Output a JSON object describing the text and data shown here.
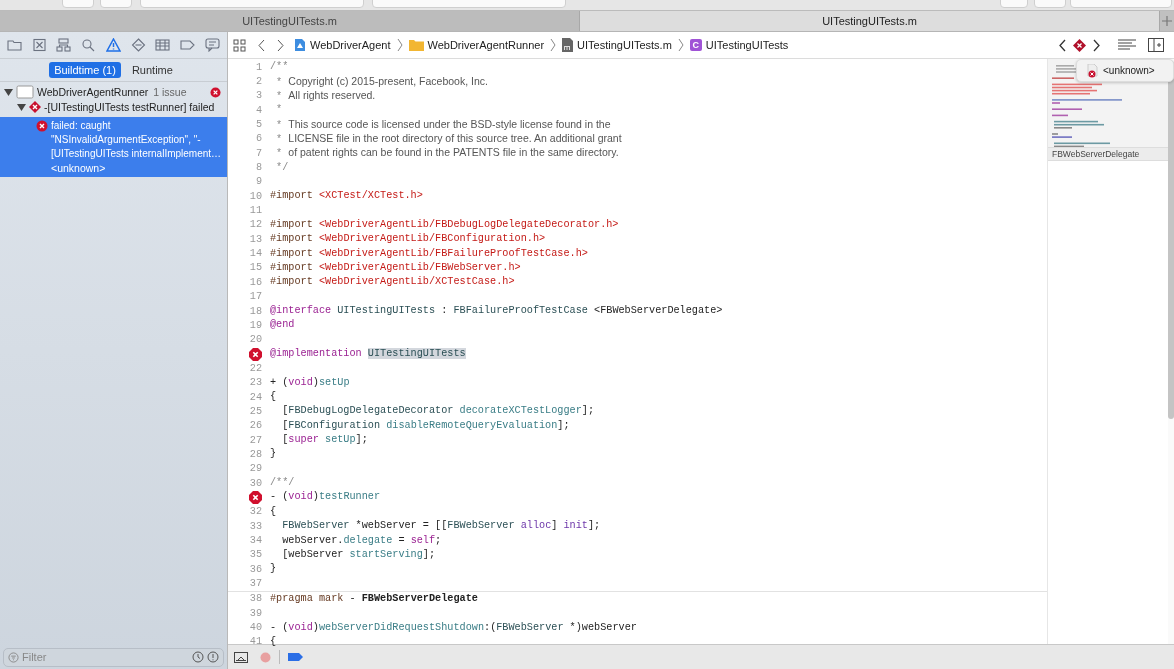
{
  "tabs": [
    {
      "label": "UITestingUITests.m",
      "selected": false
    },
    {
      "label": "UITestingUITests.m",
      "selected": true
    }
  ],
  "navigator_tabs": [
    {
      "selected": false
    },
    {
      "selected": false
    },
    {
      "selected": false
    },
    {
      "selected": false
    },
    {
      "selected": true
    },
    {
      "selected": false
    },
    {
      "selected": false
    },
    {
      "selected": false
    },
    {
      "selected": false
    }
  ],
  "scope": [
    {
      "label": "Buildtime (1)",
      "selected": true
    },
    {
      "label": "Runtime",
      "selected": false
    }
  ],
  "issues": [
    {
      "kind": "target",
      "label": "WebDriverAgentRunner",
      "count": "1 issue",
      "expanded": true,
      "selected": false,
      "children": [
        {
          "kind": "test",
          "label": "-[UITestingUITests testRunner] failed",
          "expanded": true,
          "selected": false,
          "children": [
            {
              "kind": "message",
              "label": "failed: caught \"NSInvalidArgumentException\", \"-[UITestingUITests internalImplement…",
              "detail": "<unknown>",
              "selected": true
            }
          ]
        }
      ]
    }
  ],
  "filter": {
    "placeholder": "Filter"
  },
  "jump_bar": [
    {
      "kind": "project",
      "label": "WebDriverAgent"
    },
    {
      "kind": "folder",
      "label": "WebDriverAgentRunner"
    },
    {
      "kind": "mfile",
      "label": "UITestingUITests.m"
    },
    {
      "kind": "class",
      "label": "UITestingUITests",
      "letter": "C"
    }
  ],
  "code_sections": [
    {
      "lines": [
        {
          "number": "1",
          "error": false,
          "tokens": [
            {
              "kind": "comment",
              "text": "/**"
            }
          ]
        },
        {
          "number": "2",
          "error": false,
          "tokens": [
            {
              "kind": "comment",
              "text": " * "
            },
            {
              "kind": "doc",
              "text": "Copyright (c) 2015-present, Facebook, Inc."
            }
          ]
        },
        {
          "number": "3",
          "error": false,
          "tokens": [
            {
              "kind": "comment",
              "text": " * "
            },
            {
              "kind": "doc",
              "text": "All rights reserved."
            }
          ]
        },
        {
          "number": "4",
          "error": false,
          "tokens": [
            {
              "kind": "comment",
              "text": " *"
            }
          ]
        },
        {
          "number": "5",
          "error": false,
          "tokens": [
            {
              "kind": "comment",
              "text": " * "
            },
            {
              "kind": "doc",
              "text": "This source code is licensed under the BSD-style license found in the"
            }
          ]
        },
        {
          "number": "6",
          "error": false,
          "tokens": [
            {
              "kind": "comment",
              "text": " * "
            },
            {
              "kind": "doc",
              "text": "LICENSE file in the root directory of this source tree. An additional grant"
            }
          ]
        },
        {
          "number": "7",
          "error": false,
          "tokens": [
            {
              "kind": "comment",
              "text": " * "
            },
            {
              "kind": "doc",
              "text": "of patent rights can be found in the PATENTS file in the same directory."
            }
          ]
        },
        {
          "number": "8",
          "error": false,
          "tokens": [
            {
              "kind": "comment",
              "text": " */"
            }
          ]
        },
        {
          "number": "9",
          "error": false
        },
        {
          "number": "10",
          "error": false,
          "tokens": [
            {
              "kind": "preproc",
              "text": "#import "
            },
            {
              "kind": "string",
              "text": "<XCTest/XCTest.h>"
            }
          ]
        },
        {
          "number": "11",
          "error": false
        },
        {
          "number": "12",
          "error": false,
          "tokens": [
            {
              "kind": "preproc",
              "text": "#import "
            },
            {
              "kind": "string",
              "text": "<WebDriverAgentLib/FBDebugLogDelegateDecorator.h>"
            }
          ]
        },
        {
          "number": "13",
          "error": false,
          "tokens": [
            {
              "kind": "preproc",
              "text": "#import "
            },
            {
              "kind": "string",
              "text": "<WebDriverAgentLib/FBConfiguration.h>"
            }
          ]
        },
        {
          "number": "14",
          "error": false,
          "tokens": [
            {
              "kind": "preproc",
              "text": "#import "
            },
            {
              "kind": "string",
              "text": "<WebDriverAgentLib/FBFailureProofTestCase.h>"
            }
          ]
        },
        {
          "number": "15",
          "error": false,
          "tokens": [
            {
              "kind": "preproc",
              "text": "#import "
            },
            {
              "kind": "string",
              "text": "<WebDriverAgentLib/FBWebServer.h>"
            }
          ]
        },
        {
          "number": "16",
          "error": false,
          "tokens": [
            {
              "kind": "preproc",
              "text": "#import "
            },
            {
              "kind": "string",
              "text": "<WebDriverAgentLib/XCTestCase.h>"
            }
          ]
        },
        {
          "number": "17",
          "error": false
        },
        {
          "number": "18",
          "error": false,
          "tokens": [
            {
              "kind": "keyword",
              "text": "@interface "
            },
            {
              "kind": "class",
              "text": "UITestingUITests"
            },
            {
              "kind": "plain",
              "text": " : "
            },
            {
              "kind": "class",
              "text": "FBFailureProofTestCase"
            },
            {
              "kind": "plain",
              "text": " <FBWebServerDelegate>"
            }
          ]
        },
        {
          "number": "19",
          "error": false,
          "tokens": [
            {
              "kind": "keyword",
              "text": "@end"
            }
          ]
        },
        {
          "number": "20",
          "error": false
        },
        {
          "error": true,
          "tokens": [
            {
              "kind": "keyword",
              "text": "@implementation "
            },
            {
              "kind": "selection",
              "text": "UITestingUITests"
            }
          ]
        },
        {
          "number": "22",
          "error": false
        },
        {
          "number": "23",
          "error": false,
          "tokens": [
            {
              "kind": "plain",
              "text": "+ ("
            },
            {
              "kind": "keyword",
              "text": "void"
            },
            {
              "kind": "plain",
              "text": ")"
            },
            {
              "kind": "method",
              "text": "setUp"
            }
          ]
        },
        {
          "number": "24",
          "error": false,
          "tokens": [
            {
              "kind": "plain",
              "text": "{"
            }
          ]
        },
        {
          "number": "25",
          "error": false,
          "tokens": [
            {
              "kind": "plain",
              "text": "  ["
            },
            {
              "kind": "class",
              "text": "FBDebugLogDelegateDecorator "
            },
            {
              "kind": "method",
              "text": "decorateXCTestLogger"
            },
            {
              "kind": "plain",
              "text": "];"
            }
          ]
        },
        {
          "number": "26",
          "error": false,
          "tokens": [
            {
              "kind": "plain",
              "text": "  ["
            },
            {
              "kind": "class",
              "text": "FBConfiguration "
            },
            {
              "kind": "method",
              "text": "disableRemoteQueryEvaluation"
            },
            {
              "kind": "plain",
              "text": "];"
            }
          ]
        },
        {
          "number": "27",
          "error": false,
          "tokens": [
            {
              "kind": "plain",
              "text": "  ["
            },
            {
              "kind": "keyword",
              "text": "super "
            },
            {
              "kind": "method",
              "text": "setUp"
            },
            {
              "kind": "plain",
              "text": "];"
            }
          ]
        },
        {
          "number": "28",
          "error": false,
          "tokens": [
            {
              "kind": "plain",
              "text": "}"
            }
          ]
        },
        {
          "number": "29",
          "error": false
        },
        {
          "number": "30",
          "error": false,
          "tokens": [
            {
              "kind": "comment",
              "text": "/**/"
            }
          ]
        },
        {
          "error": true,
          "tokens": [
            {
              "kind": "plain",
              "text": "- ("
            },
            {
              "kind": "keyword",
              "text": "void"
            },
            {
              "kind": "plain",
              "text": ")"
            },
            {
              "kind": "method",
              "text": "testRunner"
            }
          ]
        },
        {
          "number": "32",
          "error": false,
          "tokens": [
            {
              "kind": "plain",
              "text": "{"
            }
          ]
        },
        {
          "number": "33",
          "error": false,
          "tokens": [
            {
              "kind": "class",
              "text": "  FBWebServer"
            },
            {
              "kind": "plain",
              "text": " *webServer = [["
            },
            {
              "kind": "class",
              "text": "FBWebServer "
            },
            {
              "kind": "system",
              "text": "alloc"
            },
            {
              "kind": "plain",
              "text": "] "
            },
            {
              "kind": "system",
              "text": "init"
            },
            {
              "kind": "plain",
              "text": "];"
            }
          ]
        },
        {
          "number": "34",
          "error": false,
          "tokens": [
            {
              "kind": "plain",
              "text": "  webServer."
            },
            {
              "kind": "method",
              "text": "delegate"
            },
            {
              "kind": "plain",
              "text": " = "
            },
            {
              "kind": "keyword",
              "text": "self"
            },
            {
              "kind": "plain",
              "text": ";"
            }
          ]
        },
        {
          "number": "35",
          "error": false,
          "tokens": [
            {
              "kind": "plain",
              "text": "  [webServer "
            },
            {
              "kind": "method",
              "text": "startServing"
            },
            {
              "kind": "plain",
              "text": "];"
            }
          ]
        },
        {
          "number": "36",
          "error": false,
          "tokens": [
            {
              "kind": "plain",
              "text": "}"
            }
          ]
        },
        {
          "number": "37",
          "error": false
        }
      ]
    },
    {
      "lines": [
        {
          "number": "38",
          "error": false,
          "tokens": [
            {
              "kind": "preproc",
              "text": "#pragma mark"
            },
            {
              "kind": "plain",
              "text": " - "
            },
            {
              "kind": "mark",
              "text": "FBWebServerDelegate"
            }
          ]
        },
        {
          "number": "39",
          "error": false
        },
        {
          "number": "40",
          "error": false,
          "tokens": [
            {
              "kind": "plain",
              "text": "- ("
            },
            {
              "kind": "keyword",
              "text": "void"
            },
            {
              "kind": "plain",
              "text": ")"
            },
            {
              "kind": "method",
              "text": "webServerDidRequestShutdown"
            },
            {
              "kind": "plain",
              "text": ":("
            },
            {
              "kind": "class",
              "text": "FBWebServer"
            },
            {
              "kind": "plain",
              "text": " *)webServer"
            }
          ]
        },
        {
          "number": "41",
          "error": false,
          "tokens": [
            {
              "kind": "plain",
              "text": "{"
            }
          ]
        }
      ]
    }
  ],
  "minimap": {
    "mark_label": "FBWebServerDelegate"
  },
  "issue_popover": {
    "label": "<unknown>"
  },
  "debug_bar": {
    "breakpoints_active": true
  }
}
